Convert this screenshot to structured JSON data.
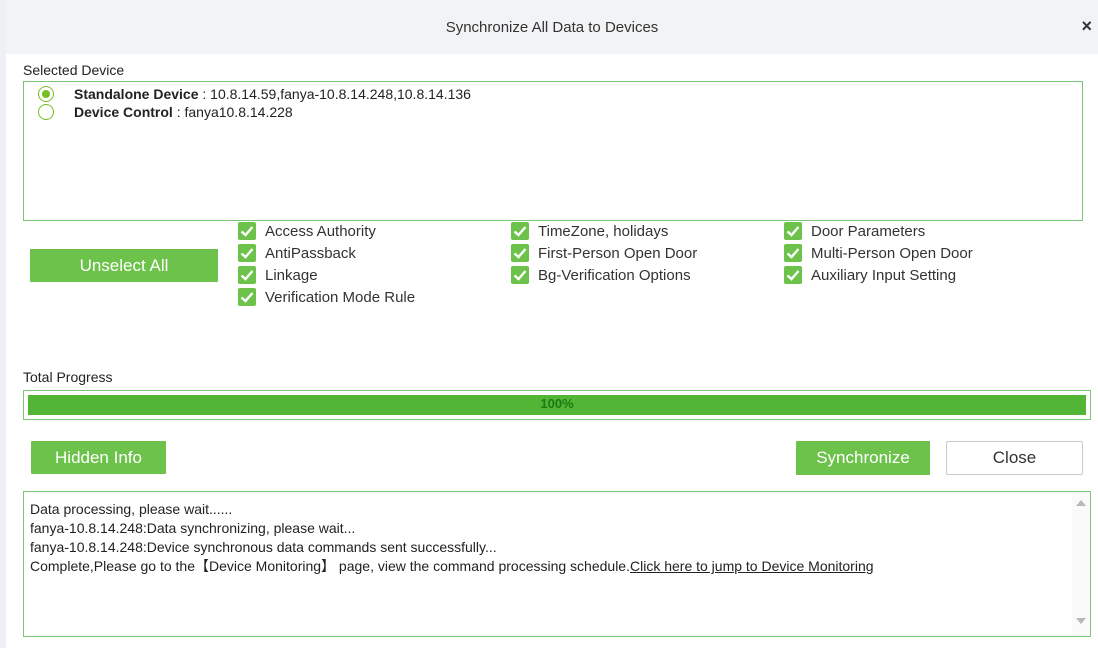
{
  "dialog": {
    "title": "Synchronize All Data to Devices",
    "close_glyph": "×"
  },
  "selected_device": {
    "label": "Selected Device",
    "devices": [
      {
        "name": "Standalone Device",
        "value": " : 10.8.14.59,fanya-10.8.14.248,10.8.14.136",
        "selected": true
      },
      {
        "name": "Device Control",
        "value": " : fanya10.8.14.228",
        "selected": false
      }
    ]
  },
  "unselect_all_label": "Unselect All",
  "options": [
    {
      "label": "Access Authority",
      "checked": true
    },
    {
      "label": "AntiPassback",
      "checked": true
    },
    {
      "label": "Linkage",
      "checked": true
    },
    {
      "label": "Verification Mode Rule",
      "checked": true
    },
    {
      "label": "TimeZone, holidays",
      "checked": true
    },
    {
      "label": "First-Person Open Door",
      "checked": true
    },
    {
      "label": "Bg-Verification Options",
      "checked": true
    },
    {
      "label": "Door Parameters",
      "checked": true
    },
    {
      "label": "Multi-Person Open Door",
      "checked": true
    },
    {
      "label": "Auxiliary Input Setting",
      "checked": true
    }
  ],
  "progress": {
    "label": "Total Progress",
    "value": 1.0,
    "text": "100%"
  },
  "buttons": {
    "hidden_info": "Hidden Info",
    "synchronize": "Synchronize",
    "close": "Close"
  },
  "log": {
    "lines": [
      "Data processing, please wait......",
      "fanya-10.8.14.248:Data synchronizing, please wait...",
      "fanya-10.8.14.248:Device synchronous data commands sent successfully..."
    ],
    "last_line_text": "Complete,Please go to the【Device Monitoring】 page, view the command processing schedule.",
    "last_line_link": "Click here to jump to Device Monitoring"
  },
  "colors": {
    "accent_green": "#6cc24a",
    "border_green": "#7cc576",
    "progress_green": "#53b535"
  },
  "icons": {
    "check": "check-icon",
    "close": "close-icon",
    "scroll_up": "scroll-up-arrow-icon",
    "scroll_down": "scroll-down-arrow-icon"
  }
}
